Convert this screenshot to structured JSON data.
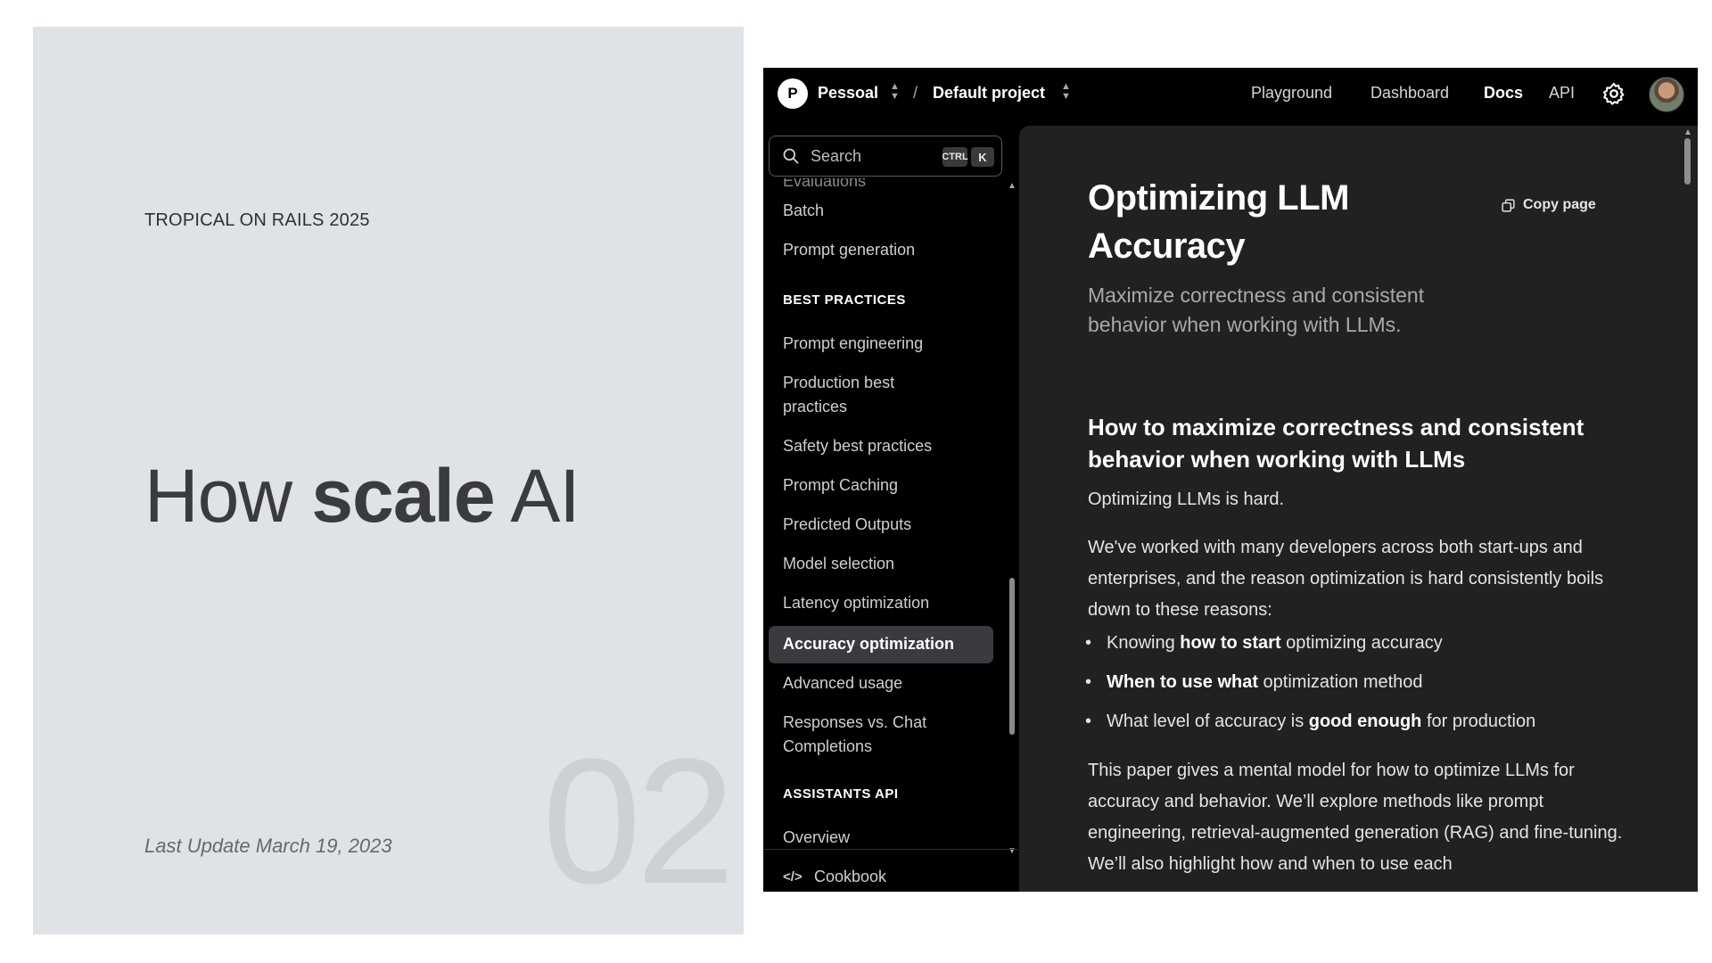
{
  "slide": {
    "eyebrow": "TROPICAL ON RAILS 2025",
    "headline_pre": "How",
    "headline_bold": "scale",
    "headline_post": "AI",
    "number": "02",
    "updated": "Last Update March 19, 2023"
  },
  "topbar": {
    "avatar_letter": "P",
    "org": "Pessoal",
    "separator": "/",
    "project": "Default project",
    "nav": [
      "Playground",
      "Dashboard",
      "Docs",
      "API"
    ],
    "active_nav": "Docs",
    "settings_icon": "gear-icon",
    "user_avatar": "user-avatar"
  },
  "sidebar": {
    "search_placeholder": "Search",
    "shortcut_ctrl": "CTRL",
    "shortcut_key": "K",
    "cut_item": "Evaluations",
    "items_top": [
      "Batch",
      "Prompt generation"
    ],
    "section_best": "BEST PRACTICES",
    "items_best": [
      "Prompt engineering",
      "Production best practices",
      "Safety best practices",
      "Prompt Caching",
      "Predicted Outputs",
      "Model selection",
      "Latency optimization",
      "Accuracy optimization",
      "Advanced usage",
      "Responses vs. Chat Completions"
    ],
    "active_item": "Accuracy optimization",
    "section_assistants": "ASSISTANTS API",
    "items_assistants": [
      "Overview"
    ],
    "cookbook_icon": "</>",
    "cookbook": "Cookbook"
  },
  "main": {
    "title": "Optimizing LLM Accuracy",
    "copy_label": "Copy page",
    "subtitle": "Maximize correctness and consistent behavior when working with LLMs.",
    "h2": "How to maximize correctness and consistent behavior when working with LLMs",
    "p1": "Optimizing LLMs is hard.",
    "p2": "We've worked with many developers across both start-ups and enterprises, and the reason optimization is hard consistently boils down to these reasons:",
    "bullets": [
      {
        "pre": "Knowing ",
        "bold": "how to start",
        "post": " optimizing accuracy"
      },
      {
        "pre": "",
        "bold": "When to use what",
        "post": " optimization method"
      },
      {
        "pre": "What level of accuracy is ",
        "bold": "good enough",
        "post": " for production"
      }
    ],
    "p3": "This paper gives a mental model for how to optimize LLMs for accuracy and behavior. We’ll explore methods like prompt engineering, retrieval-augmented generation (RAG) and fine-tuning. We’ll also highlight how and when to use each"
  }
}
